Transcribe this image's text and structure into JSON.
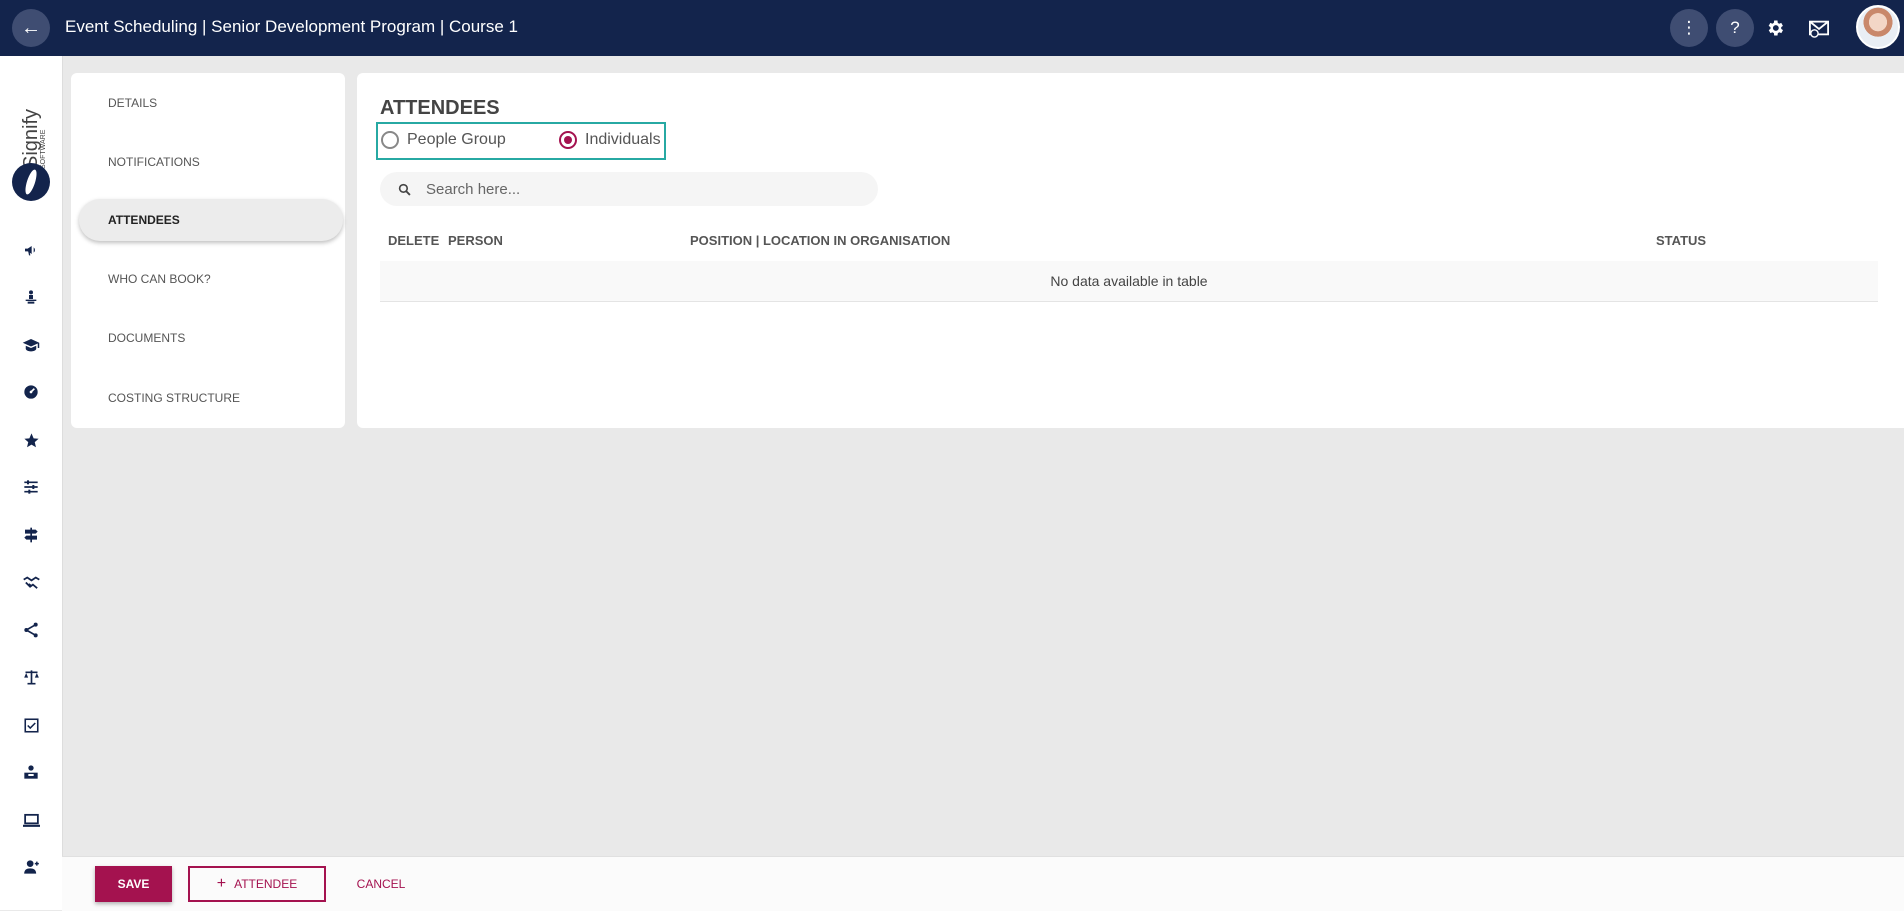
{
  "header": {
    "back_icon": "arrow-left-icon",
    "title": "Event Scheduling | Senior Development Program | Course 1",
    "icons": [
      "more-vert-icon",
      "help-icon",
      "gear-icon",
      "mail-icon",
      "avatar"
    ],
    "help_glyph": "?"
  },
  "rail": {
    "logo_text": "Signify",
    "logo_subtext": "SOFTWARE",
    "icons": [
      "megaphone-icon",
      "person-podium-icon",
      "graduation-cap-icon",
      "speedometer-icon",
      "star-icon",
      "sliders-icon",
      "signpost-icon",
      "handshake-icon",
      "network-icon",
      "scale-icon",
      "checkbox-icon",
      "person-desk-icon",
      "laptop-icon",
      "add-person-icon"
    ]
  },
  "sections": {
    "items": [
      {
        "label": "DETAILS",
        "active": false
      },
      {
        "label": "NOTIFICATIONS",
        "active": false
      },
      {
        "label": "ATTENDEES",
        "active": true
      },
      {
        "label": "WHO CAN BOOK?",
        "active": false
      },
      {
        "label": "DOCUMENTS",
        "active": false
      },
      {
        "label": "COSTING STRUCTURE",
        "active": false
      }
    ]
  },
  "main": {
    "title": "ATTENDEES",
    "radio": {
      "options": [
        {
          "label": "People Group",
          "checked": false
        },
        {
          "label": "Individuals",
          "checked": true
        }
      ]
    },
    "search": {
      "placeholder": "Search here...",
      "value": ""
    },
    "table": {
      "columns": [
        "DELETE",
        "PERSON",
        "POSITION | LOCATION IN ORGANISATION",
        "STATUS"
      ],
      "empty_message": "No data available in table"
    }
  },
  "footer": {
    "save_label": "SAVE",
    "add_attendee_label": "ATTENDEE",
    "add_attendee_icon": "plus-icon",
    "cancel_label": "CANCEL"
  },
  "colors": {
    "header_bg": "#13244c",
    "accent": "#a4124f",
    "highlight_border": "#27a9a3"
  }
}
